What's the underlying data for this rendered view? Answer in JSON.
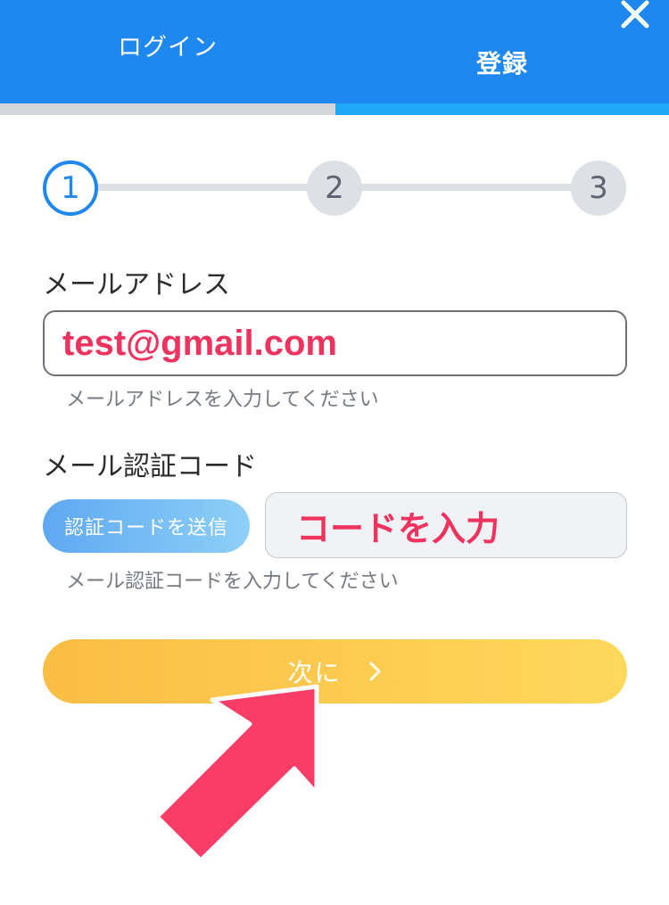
{
  "tabs": {
    "login_label": "ログイン",
    "register_label": "登録"
  },
  "stepper": {
    "steps": [
      "1",
      "2",
      "3"
    ],
    "current": 1
  },
  "email": {
    "label": "メールアドレス",
    "value": "test@gmail.com",
    "hint": "メールアドレスを入力してください"
  },
  "code": {
    "label": "メール認証コード",
    "send_button": "認証コードを送信",
    "value": "コードを入力",
    "hint": "メール認証コードを入力してください"
  },
  "next_button": {
    "label": "次に"
  },
  "icons": {
    "close": "close-icon",
    "chevron": "chevron-right-icon",
    "pointer": "pointer-arrow-icon"
  },
  "colors": {
    "header": "#1e88f0",
    "accent": "#1e88f0",
    "highlight": "#f0335e",
    "next_button_start": "#fbbd44",
    "next_button_end": "#fed85b"
  }
}
